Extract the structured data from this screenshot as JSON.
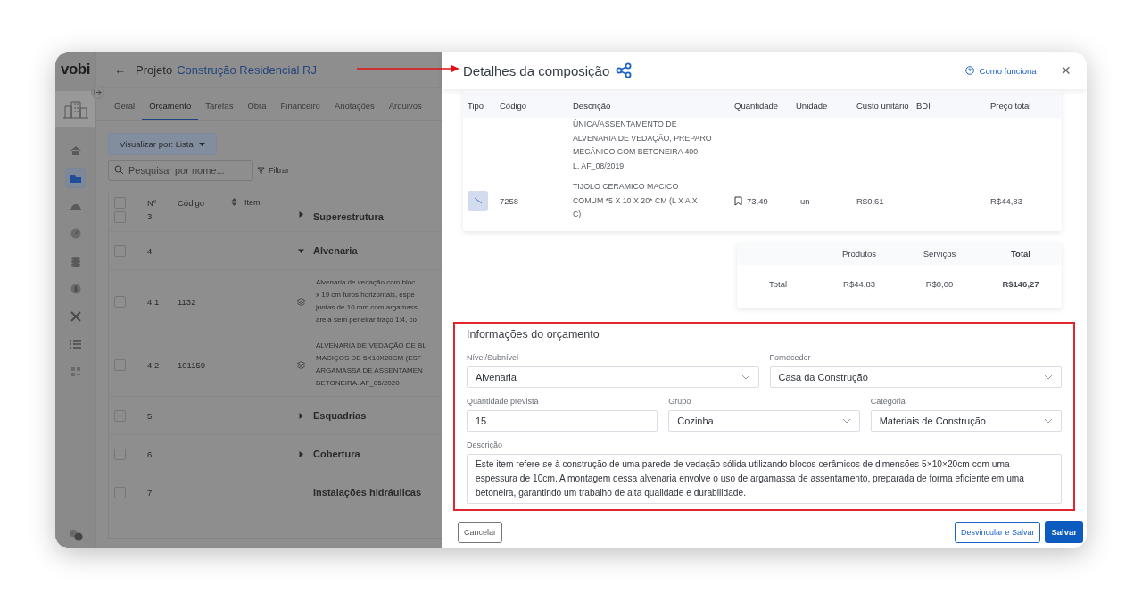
{
  "app": {
    "logo": "vobi",
    "back": "←",
    "project_prefix": "Projeto",
    "project_name": "Construção Residencial RJ",
    "sidebar": [
      {
        "selected": false
      },
      {
        "selected": true
      },
      {
        "selected": false
      },
      {
        "selected": false
      },
      {
        "selected": false
      },
      {
        "selected": false
      },
      {
        "selected": false
      },
      {
        "selected": false
      },
      {
        "selected": false
      }
    ],
    "select_all_checked": false,
    "tabs": [
      {
        "label": "Geral",
        "selected": false
      },
      {
        "label": "Orçamento",
        "selected": true
      },
      {
        "label": "Tarefas",
        "selected": false
      },
      {
        "label": "Obra",
        "selected": false
      },
      {
        "label": "Financeiro",
        "selected": false
      },
      {
        "label": "Anotações",
        "selected": false
      },
      {
        "label": "Arquivos",
        "selected": false
      }
    ],
    "view_button": "Visualizar por: Lista",
    "search": {
      "placeholder": "Pesquisar por nome..."
    },
    "filter": "Filtrar",
    "columns": [
      "Nº",
      "Código",
      "Item"
    ],
    "rows": [
      {
        "kind": "group",
        "number": "3",
        "title": "Superestrutura",
        "expanded": false,
        "checked": false
      },
      {
        "kind": "group",
        "number": "4",
        "title": "Alvenaria",
        "expanded": true,
        "checked": false
      },
      {
        "kind": "item",
        "checked": false,
        "number": "4.1",
        "code": "1132",
        "lines": [
          "Alvenaria de vedação com bloc",
          "x 19 cm furos horizontais, espe",
          "juntas de 10 mm com argamass",
          "areia sem peneirar traço 1:4, co"
        ]
      },
      {
        "kind": "item",
        "checked": false,
        "number": "4.2",
        "code": "101159",
        "lines": [
          "ALVENARIA DE VEDAÇÃO DE BL",
          "MACIÇOS DE 5X10X20CM (ESF",
          "ARGAMASSA DE ASSENTAMEN",
          "BETONEIRA. AF_05/2020"
        ]
      },
      {
        "kind": "group",
        "number": "5",
        "title": "Esquadrias",
        "expanded": false,
        "checked": false
      },
      {
        "kind": "group",
        "number": "6",
        "title": "Cobertura",
        "expanded": false,
        "checked": false
      },
      {
        "kind": "heading",
        "number": "7",
        "title": "Instalações hidráulicas",
        "checked": false
      }
    ]
  },
  "drawer": {
    "title": "Detalhes da composição",
    "help": "Como funciona",
    "close": "×",
    "columns": [
      "Tipo",
      "Código",
      "Descrição",
      "Quantidade",
      "Unidade",
      "Custo unitário",
      "BDI",
      "Preço total"
    ],
    "rows": [
      {
        "kind": "partial",
        "description": [
          "ÚNICA/ASSENTAMENTO DE",
          "ALVENARIA DE VEDAÇÃO, PREPARO",
          "MECÂNICO COM BETONEIRA 400",
          "L. AF_08/2019"
        ]
      },
      {
        "kind": "product",
        "code": "7258",
        "description": [
          "TIJOLO CERAMICO MACICO",
          "COMUM *5 X 10 X 20* CM (L X A X",
          "C)"
        ],
        "quantity": "73,49",
        "unit": "un",
        "unit_cost": "R$0,61",
        "bdi": "-",
        "total": "R$44,83"
      }
    ],
    "totals": {
      "columns": [
        "Produtos",
        "Serviços",
        "Total"
      ],
      "label": "Total",
      "values": [
        "R$44,83",
        "R$0,00",
        "R$146,27"
      ]
    },
    "form": {
      "title": "Informações do orçamento",
      "rows": [
        [
          {
            "label": "Nível/Subnível",
            "value": "Alvenaria",
            "kind": "select"
          },
          {
            "label": "Fornecedor",
            "value": "Casa da Construção",
            "kind": "select"
          }
        ],
        [
          {
            "label": "Quantidade prevista",
            "value": "15",
            "kind": "input"
          },
          {
            "label": "Grupo",
            "value": "Cozinha",
            "kind": "select"
          },
          {
            "label": "Categoria",
            "value": "Materiais de Construção",
            "kind": "select"
          }
        ],
        [
          {
            "label": "Descrição",
            "value": "Este item refere-se à construção de uma parede de vedação sólida utilizando blocos cerâmicos de dimensões 5×10×20cm com uma espessura de 10cm. A montagem dessa alvenaria envolve o uso de argamassa de assentamento, preparada de forma eficiente em uma betoneira, garantindo um trabalho de alta qualidade e durabilidade.",
            "kind": "textarea"
          }
        ]
      ]
    },
    "buttons": {
      "cancel": "Cancelar",
      "unlink": "Desvincular e Salvar",
      "save": "Salvar"
    }
  }
}
